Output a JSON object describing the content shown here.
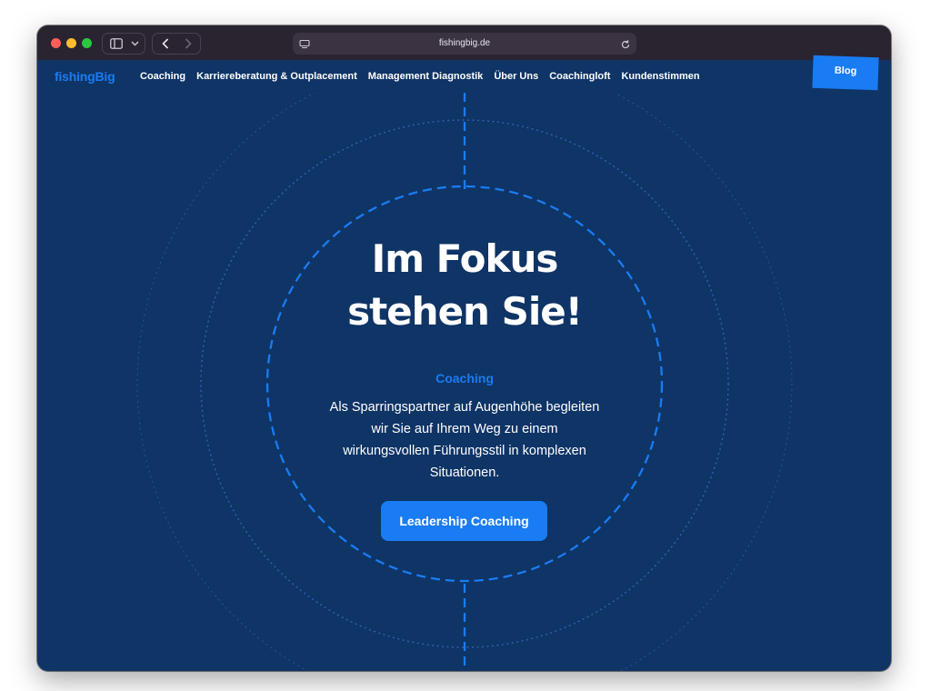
{
  "browser": {
    "url": "fishingbig.de",
    "colors": {
      "titlebar": "#2a2330",
      "close": "#ff5f57",
      "minimize": "#febc2e",
      "maximize": "#28c840"
    }
  },
  "nav": {
    "logo": "fishingBig",
    "items": [
      "Coaching",
      "Karriereberatung & Outplacement",
      "Management Diagnostik",
      "Über Uns",
      "Coachingloft",
      "Kundenstimmen"
    ],
    "blog": "Blog"
  },
  "hero": {
    "headline_line1": "Im Fokus",
    "headline_line2": "stehen Sie!",
    "kicker": "Coaching",
    "description": "Als Sparringspartner auf Augenhöhe begleiten wir Sie auf Ihrem Weg zu einem wirkungsvollen Führungsstil in komplexen Situationen.",
    "cta": "Leadership Coaching"
  },
  "colors": {
    "background": "#0f3466",
    "accent": "#1a7cf2",
    "text": "#ffffff"
  },
  "icons": [
    "sidebar-icon",
    "chevron-down-icon",
    "back-arrow-icon",
    "forward-arrow-icon",
    "reader-icon",
    "reload-icon"
  ]
}
